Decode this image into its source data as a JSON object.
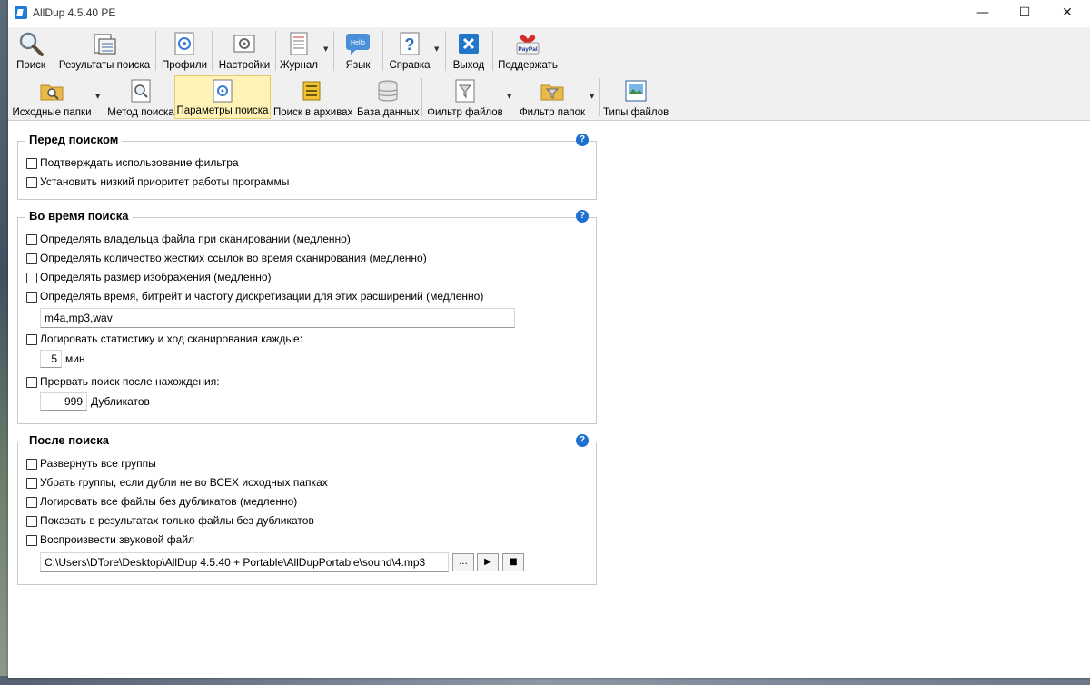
{
  "window": {
    "title": "AllDup 4.5.40 PE",
    "controls": {
      "minimize": "—",
      "maximize": "☐",
      "close": "✕"
    }
  },
  "toolbar_main": [
    {
      "label": "Поиск",
      "icon": "magnifier-icon"
    },
    {
      "label": "Результаты поиска",
      "icon": "results-icon"
    },
    {
      "label": "Профили",
      "icon": "profiles-icon"
    },
    {
      "label": "Настройки",
      "icon": "settings-icon"
    },
    {
      "label": "Журнал",
      "icon": "log-icon"
    },
    {
      "label": "Язык",
      "icon": "hello-bubble-icon",
      "icon_text": "Hello"
    },
    {
      "label": "Справка",
      "icon": "help-question-icon"
    },
    {
      "label": "Выход",
      "icon": "exit-icon"
    },
    {
      "label": "Поддержать",
      "icon": "paypal-icon",
      "icon_text": "PayPal"
    }
  ],
  "toolbar_sections": [
    {
      "label": "Исходные папки",
      "icon": "source-folders-icon"
    },
    {
      "label": "Метод поиска",
      "icon": "search-method-icon"
    },
    {
      "label": "Параметры поиска",
      "icon": "search-options-icon",
      "active": true
    },
    {
      "label": "Поиск в архивах",
      "icon": "archive-icon"
    },
    {
      "label": "База данных",
      "icon": "database-icon"
    },
    {
      "label": "Фильтр файлов",
      "icon": "file-filter-icon"
    },
    {
      "label": "Фильтр папок",
      "icon": "folder-filter-icon"
    },
    {
      "label": "Типы файлов",
      "icon": "file-types-icon"
    }
  ],
  "before_search": {
    "title": "Перед поиском",
    "options": [
      {
        "label": "Подтверждать использование фильтра",
        "checked": false
      },
      {
        "label": "Установить низкий приоритет работы программы",
        "checked": false
      }
    ]
  },
  "during_search": {
    "title": "Во время поиска",
    "options": [
      {
        "label": "Определять владельца файла при сканировании (медленно)",
        "checked": false
      },
      {
        "label": "Определять количество жестких ссылок во время сканирования (медленно)",
        "checked": false
      },
      {
        "label": "Определять размер изображения (медленно)",
        "checked": false
      },
      {
        "label": "Определять время, битрейт и частоту дискретизации для этих расширений (медленно)",
        "checked": false
      }
    ],
    "extensions_value": "m4a,mp3,wav",
    "log_stats_label": "Логировать статистику и ход сканирования каждые:",
    "log_interval_value": "5",
    "log_interval_unit": "мин",
    "stop_after_label": "Прервать поиск после нахождения:",
    "stop_after_value": "999",
    "stop_after_unit": "Дубликатов"
  },
  "after_search": {
    "title": "После поиска",
    "options": [
      {
        "label": "Развернуть все группы",
        "checked": false
      },
      {
        "label": "Убрать группы, если дубли не во ВСЕХ исходных папках",
        "checked": false
      },
      {
        "label": "Логировать все файлы без дубликатов (медленно)",
        "checked": false
      },
      {
        "label": "Показать в результатах только файлы без дубликатов",
        "checked": false
      },
      {
        "label": "Воспроизвести звуковой файл",
        "checked": false
      }
    ],
    "sound_path": "C:\\Users\\DTore\\Desktop\\AllDup 4.5.40 + Portable\\AllDupPortable\\sound\\4.mp3",
    "browse_label": "...",
    "play_label": "▶",
    "stop_label": "■"
  },
  "help_glyph": "?"
}
